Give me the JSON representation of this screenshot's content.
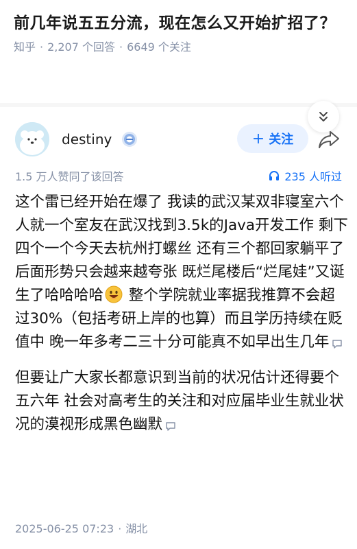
{
  "question": {
    "title": "前几年说五五分流，现在怎么又开始扩招了？",
    "source": "知乎",
    "answers_count": "2,207 个回答",
    "followers_count": "6649 个关注"
  },
  "author": {
    "name": "destiny",
    "follow_label": "关注",
    "avatar_icon": "bear-avatar",
    "badge_icon": "badge-icon"
  },
  "stats": {
    "likes": "1.5 万人赞同了该回答",
    "listens": "235 人听过"
  },
  "answer": {
    "paragraph1_part1": "这个雷已经开始在爆了 我读的武汉某双非寝室六个人就一个室友在武汉找到3.5k的Java开发工作 剩下四个一个今天去杭州打螺丝 还有三个都回家躺平了 后面形势只会越来越夸张 既烂尾楼后“烂尾娃”又诞生了哈哈哈哈",
    "paragraph1_part2": " 整个学院就业率据我推算不会超过30%（包括考研上岸的也算）而且学历持续在贬值中 晚一年多考二三十分可能真不如早出生几年",
    "paragraph2": "但要让广大家长都意识到当前的状况估计还得要个五六年 社会对高考生的关注和对应届毕业生就业状况的漠视形成黑色幽默"
  },
  "footer": {
    "datetime": "2025-06-25 07:23",
    "location": "湖北"
  },
  "colors": {
    "accent": "#1772f6",
    "meta": "#8590a6",
    "follow_bg": "#eaf2ff"
  }
}
